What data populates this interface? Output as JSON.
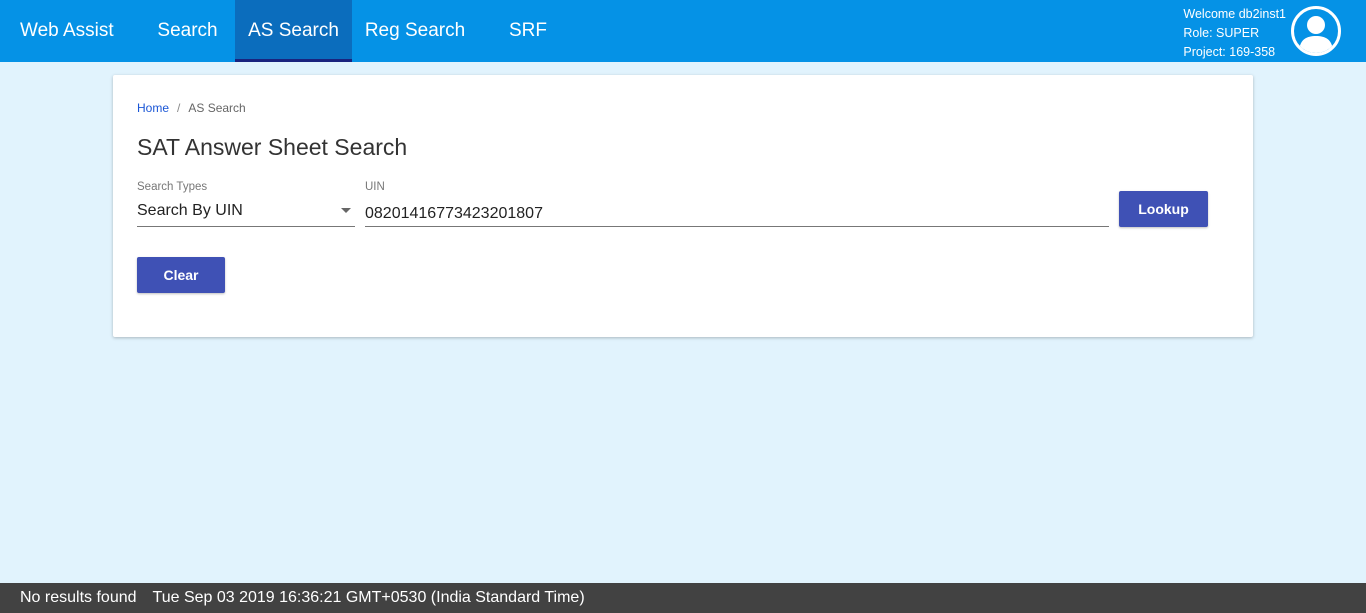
{
  "header": {
    "brand": "Web Assist",
    "nav": [
      {
        "label": "Search"
      },
      {
        "label": "AS Search"
      },
      {
        "label": "Reg Search"
      },
      {
        "label": "SRF"
      }
    ],
    "user": {
      "welcome": "Welcome db2inst1",
      "role": "Role: SUPER",
      "project": "Project: 169-358",
      "avatar_icon": "user-avatar-icon"
    },
    "active_nav": "AS Search",
    "colors": {
      "bar": "#0592e6",
      "active": "#0b6dbd"
    }
  },
  "breadcrumb": {
    "home": "Home",
    "separator": "/",
    "current": "AS Search"
  },
  "page": {
    "title": "SAT Answer Sheet Search",
    "search_types": {
      "label": "Search Types",
      "value": "Search By UIN"
    },
    "uin": {
      "label": "UIN",
      "value": "08201416773423201807"
    },
    "lookup_label": "Lookup",
    "clear_label": "Clear"
  },
  "status": {
    "message": "No results found",
    "timestamp": "Tue Sep 03 2019 16:36:21 GMT+0530 (India Standard Time)"
  }
}
